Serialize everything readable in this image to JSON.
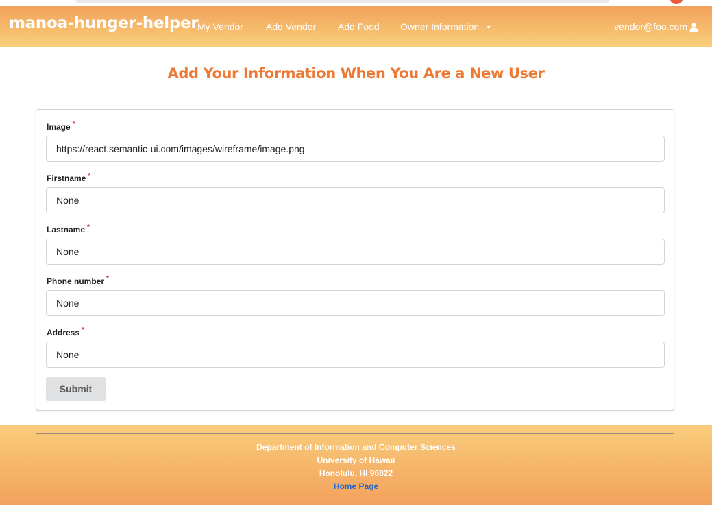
{
  "navbar": {
    "brand": "manoa-hunger-helper",
    "items": [
      {
        "label": "My Vendor"
      },
      {
        "label": "Add Vendor"
      },
      {
        "label": "Add Food"
      },
      {
        "label": "Owner Information"
      }
    ],
    "user_email": "vendor@foo.com"
  },
  "page": {
    "title": "Add Your Information When You Are a New User"
  },
  "form": {
    "fields": [
      {
        "label": "Image",
        "required_mark": "*",
        "value": "https://react.semantic-ui.com/images/wireframe/image.png"
      },
      {
        "label": "Firstname",
        "required_mark": "*",
        "value": "None"
      },
      {
        "label": "Lastname",
        "required_mark": "*",
        "value": "None"
      },
      {
        "label": "Phone number",
        "required_mark": "*",
        "value": "None"
      },
      {
        "label": "Address",
        "required_mark": "*",
        "value": "None"
      }
    ],
    "submit_label": "Submit"
  },
  "footer": {
    "line1": "Department of Information and Computer Sciences",
    "line2": "University of Hawaii",
    "line3": "Honolulu, HI 96822",
    "link": "Home Page"
  },
  "colors": {
    "accent": "#ec7a35",
    "navbar_top": "#f3a15e",
    "navbar_bottom": "#f9d07d",
    "required": "#db2828",
    "link": "#2a66c9"
  },
  "icons": {
    "user": "user-icon",
    "dropdown": "caret-down-icon"
  }
}
